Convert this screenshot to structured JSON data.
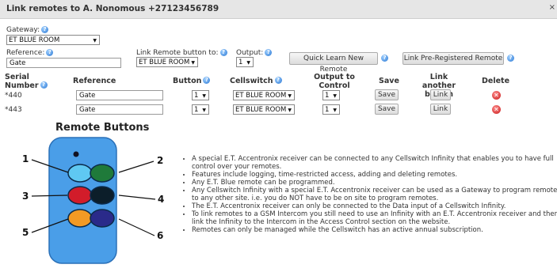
{
  "dialog": {
    "title": "Link remotes to A. Nonomous +27123456789",
    "close": "×"
  },
  "gateway": {
    "label": "Gateway:",
    "value": "ET BLUE ROOM"
  },
  "reference": {
    "label": "Reference:",
    "value": "Gate"
  },
  "link_remote": {
    "label": "Link Remote button to:",
    "value": "ET BLUE ROOM"
  },
  "output": {
    "label": "Output:",
    "value": "1"
  },
  "buttons": {
    "quick_learn": "Quick Learn New Remote",
    "link_preregistered": "Link Pre-Registered Remote"
  },
  "table": {
    "headers": {
      "serial": "Serial Number",
      "reference": "Reference",
      "button": "Button",
      "cellswitch": "Cellswitch",
      "output": "Output to Control",
      "save": "Save",
      "link_another": "Link another button",
      "delete": "Delete"
    },
    "rows": [
      {
        "serial": "*440",
        "reference": "Gate",
        "button": "1",
        "cellswitch": "ET BLUE ROOM",
        "output": "1",
        "save": "Save",
        "link": "Link"
      },
      {
        "serial": "*443",
        "reference": "Gate",
        "button": "1",
        "cellswitch": "ET BLUE ROOM",
        "output": "1",
        "save": "Save",
        "link": "Link"
      }
    ]
  },
  "remote": {
    "title": "Remote Buttons",
    "numbers": [
      "1",
      "2",
      "3",
      "4",
      "5",
      "6"
    ],
    "colors": {
      "body": "#4a9ee8",
      "b1": "#5fc8f2",
      "b2": "#1f7a3a",
      "b3": "#d21c2a",
      "b4": "#0c1e2a",
      "b5": "#f39a24",
      "b6": "#2a2a8a"
    }
  },
  "info": [
    "A special E.T. Accentronix receiver can be connected to any Cellswitch Infinity that enables you to have full control over your remotes.",
    "Features include logging, time-restricted access, adding and deleting remotes.",
    "Any E.T. Blue remote can be programmed.",
    "Any Cellswitch Infinity with a special E.T. Accentronix receiver can be used as a Gateway to program remotes to any other site. i.e. you do NOT have to be on site to program remotes.",
    "The E.T. Accentronix receiver can only be connected to the Data input of a Cellswitch Infinity.",
    "To link remotes to a GSM Intercom you still need to use an Infinity with an E.T. Accentronix receiver and then link the Infinity to the Intercom in the Access Control section on the website.",
    "Remotes can only be managed while the Cellswitch has an active annual subscription."
  ]
}
